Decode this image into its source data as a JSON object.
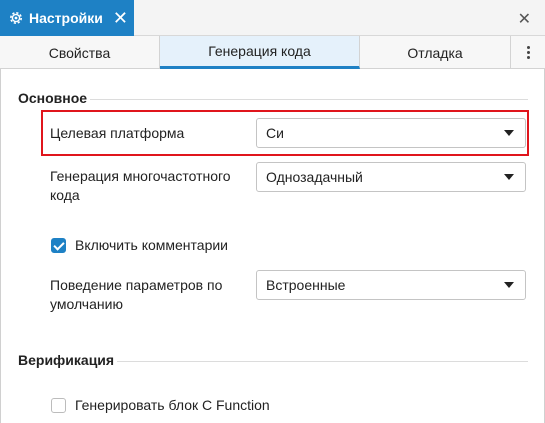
{
  "window": {
    "tab_title": "Настройки",
    "tab_close": "✕",
    "panel_close": "✕"
  },
  "subtabs": [
    {
      "label": "Свойства"
    },
    {
      "label": "Генерация кода",
      "active": true
    },
    {
      "label": "Отладка"
    }
  ],
  "sections": {
    "basic": {
      "title": "Основное",
      "target_platform": {
        "label": "Целевая платформа",
        "value": "Си"
      },
      "multirate": {
        "label_line1": "Генерация многочастотного",
        "label_line2": "кода",
        "value": "Однозадачный"
      },
      "comments": {
        "label": "Включить комментарии",
        "checked": true
      },
      "param_behavior": {
        "label_line1": "Поведение параметров по",
        "label_line2": "умолчанию",
        "value": "Встроенные"
      }
    },
    "verification": {
      "title": "Верификация",
      "c_function": {
        "label": "Генерировать блок C Function",
        "checked": false
      }
    }
  },
  "colors": {
    "accent": "#1e81c5",
    "highlight": "#e0151c"
  }
}
